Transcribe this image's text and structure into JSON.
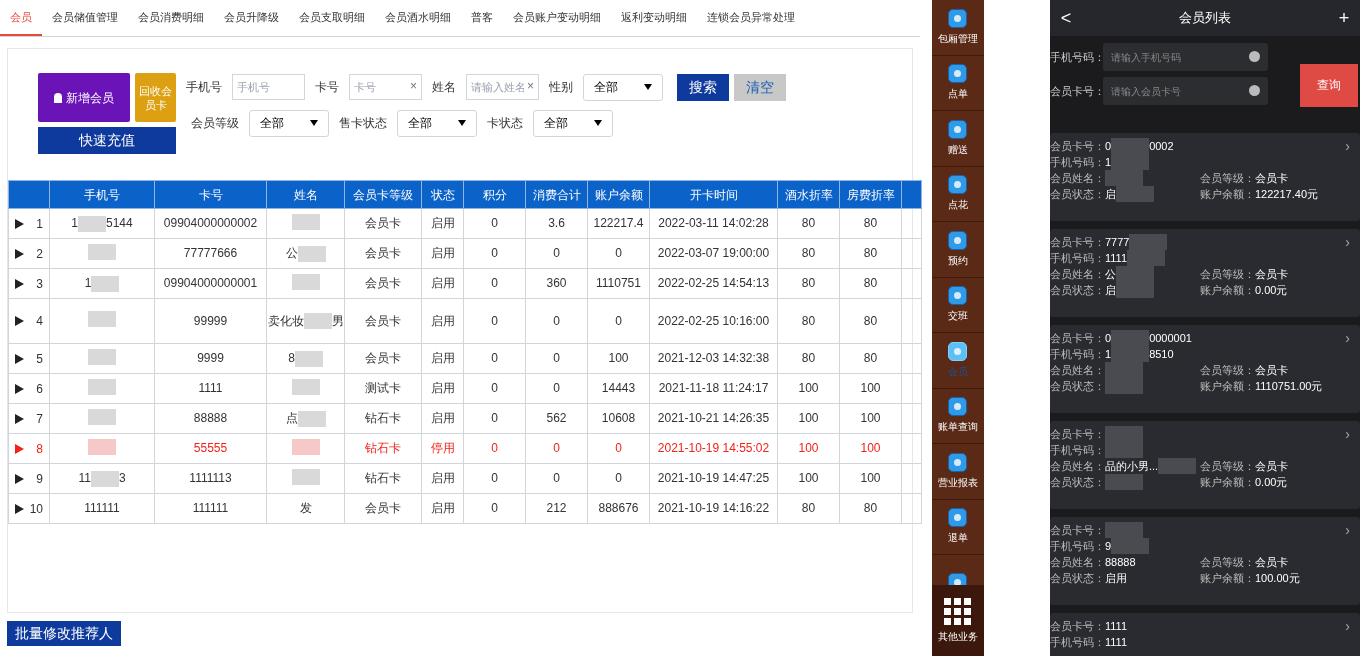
{
  "tabs": [
    {
      "label": "会员",
      "selected": true
    },
    {
      "label": "会员储值管理",
      "selected": false
    },
    {
      "label": "会员消费明细",
      "selected": false
    },
    {
      "label": "会员升降级",
      "selected": false
    },
    {
      "label": "会员支取明细",
      "selected": false
    },
    {
      "label": "会员酒水明细",
      "selected": false
    },
    {
      "label": "普客",
      "selected": false
    },
    {
      "label": "会员账户变动明细",
      "selected": false
    },
    {
      "label": "返利变动明细",
      "selected": false
    },
    {
      "label": "连锁会员异常处理",
      "selected": false
    }
  ],
  "actions": [
    {
      "kind": "add",
      "label": "新增会员"
    },
    {
      "kind": "recycle",
      "label": "回收会员卡"
    },
    {
      "kind": "recharge",
      "label": "快速充值"
    }
  ],
  "filter_rows": [
    [
      {
        "kind": "input",
        "label": "手机号",
        "placeholder": "手机号"
      },
      {
        "kind": "input",
        "label": "卡号",
        "placeholder": "卡号",
        "clear": "×"
      },
      {
        "kind": "input",
        "label": "姓名",
        "placeholder": "请输入姓名",
        "clear": "×"
      },
      {
        "kind": "select",
        "label": "性别",
        "value": "全部"
      },
      {
        "kind": "search",
        "label": "搜索"
      },
      {
        "kind": "reset",
        "label": "清空"
      }
    ],
    [
      {
        "kind": "select",
        "label": "会员等级",
        "value": "全部"
      },
      {
        "kind": "select",
        "label": "售卡状态",
        "value": "全部"
      },
      {
        "kind": "select",
        "label": "卡状态",
        "value": "全部"
      }
    ]
  ],
  "table": {
    "columns": [
      "手机号",
      "卡号",
      "姓名",
      "会员卡等级",
      "状态",
      "积分",
      "消费合计",
      "账户余额",
      "开卡时间",
      "酒水折率",
      "房费折率"
    ],
    "rows": [
      {
        "index": "1",
        "disabled": false,
        "cells": [
          {
            "kind": "masked",
            "shown": [
              "1",
              "5144"
            ]
          },
          "09904000000002",
          {
            "kind": "masked"
          },
          "会员卡",
          "启用",
          "0",
          "3.6",
          "122217.4",
          "2022-03-11 14:02:28",
          "80",
          "80"
        ]
      },
      {
        "index": "2",
        "disabled": false,
        "cells": [
          {
            "kind": "masked"
          },
          "77777666",
          {
            "kind": "masked",
            "shown": [
              "公"
            ]
          },
          "会员卡",
          "启用",
          "0",
          "0",
          "0",
          "2022-03-07 19:00:00",
          "80",
          "80"
        ]
      },
      {
        "index": "3",
        "disabled": false,
        "cells": [
          {
            "kind": "masked",
            "shown": [
              "1"
            ]
          },
          "09904000000001",
          {
            "kind": "masked"
          },
          "会员卡",
          "启用",
          "0",
          "360",
          "1110751",
          "2022-02-25 14:54:13",
          "80",
          "80"
        ]
      },
      {
        "index": "4",
        "disabled": false,
        "cells": [
          {
            "kind": "masked"
          },
          "99999",
          {
            "kind": "masked",
            "shown": [
              "卖化妆",
              "男"
            ]
          },
          "会员卡",
          "启用",
          "0",
          "0",
          "0",
          "2022-02-25 10:16:00",
          "80",
          "80"
        ]
      },
      {
        "index": "5",
        "disabled": false,
        "cells": [
          {
            "kind": "masked"
          },
          "9999",
          {
            "kind": "masked",
            "shown": [
              "8"
            ]
          },
          "会员卡",
          "启用",
          "0",
          "0",
          "100",
          "2021-12-03 14:32:38",
          "80",
          "80"
        ]
      },
      {
        "index": "6",
        "disabled": false,
        "cells": [
          {
            "kind": "masked"
          },
          "1111",
          {
            "kind": "masked"
          },
          "测试卡",
          "启用",
          "0",
          "0",
          "14443",
          "2021-11-18 11:24:17",
          "100",
          "100"
        ]
      },
      {
        "index": "7",
        "disabled": false,
        "cells": [
          {
            "kind": "masked"
          },
          "88888",
          {
            "kind": "masked",
            "shown": [
              "点"
            ]
          },
          "钻石卡",
          "启用",
          "0",
          "562",
          "10608",
          "2021-10-21 14:26:35",
          "100",
          "100"
        ]
      },
      {
        "index": "8",
        "disabled": true,
        "cells": [
          {
            "kind": "masked"
          },
          "55555",
          {
            "kind": "masked"
          },
          "钻石卡",
          "停用",
          "0",
          "0",
          "0",
          "2021-10-19 14:55:02",
          "100",
          "100"
        ]
      },
      {
        "index": "9",
        "disabled": false,
        "cells": [
          {
            "kind": "masked",
            "shown": [
              "11",
              "3"
            ]
          },
          "1111113",
          {
            "kind": "masked"
          },
          "钻石卡",
          "启用",
          "0",
          "0",
          "0",
          "2021-10-19 14:47:25",
          "100",
          "100"
        ]
      },
      {
        "index": "10",
        "disabled": false,
        "cells": [
          "111111",
          "111111",
          "发",
          "会员卡",
          "启用",
          "0",
          "212",
          "888676",
          "2021-10-19 14:16:22",
          "80",
          "80"
        ]
      }
    ]
  },
  "footer_button": "批量修改推荐人",
  "sidebar": {
    "items": [
      {
        "label": "包厢管理",
        "selected": false
      },
      {
        "label": "点单",
        "selected": false
      },
      {
        "label": "赠送",
        "selected": false
      },
      {
        "label": "点花",
        "selected": false
      },
      {
        "label": "预约",
        "selected": false
      },
      {
        "label": "交班",
        "selected": false
      },
      {
        "label": "会员",
        "selected": true
      },
      {
        "label": "账单查询",
        "selected": false
      },
      {
        "label": "营业报表",
        "selected": false
      },
      {
        "label": "退单",
        "selected": false
      },
      {
        "selected": false
      }
    ],
    "other": "其他业务"
  },
  "mobile": {
    "back": "<",
    "title": "会员列表",
    "add": "+",
    "fields": [
      {
        "label": "手机号码：",
        "placeholder": "请输入手机号码"
      },
      {
        "label": "会员卡号：",
        "placeholder": "请输入会员卡号"
      }
    ],
    "query_button": "查询",
    "cards": [
      {
        "chevron": "›",
        "fields": [
          {
            "label": "会员卡号：",
            "value": {
              "kind": "masked",
              "shown": [
                "0",
                "0002"
              ]
            }
          },
          {
            "label": "手机号码：",
            "value": {
              "kind": "masked",
              "shown": [
                "1"
              ]
            }
          },
          {
            "label": "会员姓名：",
            "value": {
              "kind": "masked"
            }
          },
          {
            "label": "会员状态：",
            "value": {
              "kind": "masked",
              "shown": [
                "启"
              ]
            }
          }
        ],
        "side": [
          {
            "label": "会员等级：",
            "value": "会员卡"
          },
          {
            "label": "账户余额：",
            "value": "122217.40元"
          }
        ]
      },
      {
        "chevron": "›",
        "fields": [
          {
            "label": "会员卡号：",
            "value": {
              "kind": "masked",
              "shown": [
                "7777"
              ]
            }
          },
          {
            "label": "手机号码：",
            "value": {
              "kind": "masked",
              "shown": [
                "1111"
              ]
            }
          },
          {
            "label": "会员姓名：",
            "value": {
              "kind": "masked",
              "shown": [
                "公"
              ]
            }
          },
          {
            "label": "会员状态：",
            "value": {
              "kind": "masked",
              "shown": [
                "启"
              ]
            }
          }
        ],
        "side": [
          {
            "label": "会员等级：",
            "value": "会员卡"
          },
          {
            "label": "账户余额：",
            "value": "0.00元"
          }
        ]
      },
      {
        "chevron": "›",
        "fields": [
          {
            "label": "会员卡号：",
            "value": {
              "kind": "masked",
              "shown": [
                "0",
                "0000001"
              ]
            }
          },
          {
            "label": "手机号码：",
            "value": {
              "kind": "masked",
              "shown": [
                "1",
                "8510"
              ]
            }
          },
          {
            "label": "会员姓名：",
            "value": {
              "kind": "masked"
            }
          },
          {
            "label": "会员状态：",
            "value": {
              "kind": "masked"
            }
          }
        ],
        "side": [
          {
            "label": "会员等级：",
            "value": "会员卡"
          },
          {
            "label": "账户余额：",
            "value": "1110751.00元"
          }
        ]
      },
      {
        "chevron": "›",
        "fields": [
          {
            "label": "会员卡号：",
            "value": {
              "kind": "masked"
            }
          },
          {
            "label": "手机号码：",
            "value": {
              "kind": "masked"
            }
          },
          {
            "label": "会员姓名：",
            "value": {
              "kind": "masked",
              "shown": [
                "品的小男..."
              ]
            }
          },
          {
            "label": "会员状态：",
            "value": {
              "kind": "masked"
            }
          }
        ],
        "side": [
          {
            "label": "会员等级：",
            "value": "会员卡"
          },
          {
            "label": "账户余额：",
            "value": "0.00元"
          }
        ]
      },
      {
        "chevron": "›",
        "fields": [
          {
            "label": "会员卡号：",
            "value": {
              "kind": "masked"
            }
          },
          {
            "label": "手机号码：",
            "value": {
              "kind": "masked",
              "shown": [
                "9"
              ]
            }
          },
          {
            "label": "会员姓名：",
            "value": "88888"
          },
          {
            "label": "会员状态：",
            "value": "启用"
          }
        ],
        "side": [
          {
            "label": "会员等级：",
            "value": "会员卡"
          },
          {
            "label": "账户余额：",
            "value": "100.00元"
          }
        ]
      },
      {
        "chevron": "›",
        "fields": [
          {
            "label": "会员卡号：",
            "value": "1111"
          },
          {
            "label": "手机号码：",
            "value": "1111"
          }
        ]
      }
    ]
  }
}
